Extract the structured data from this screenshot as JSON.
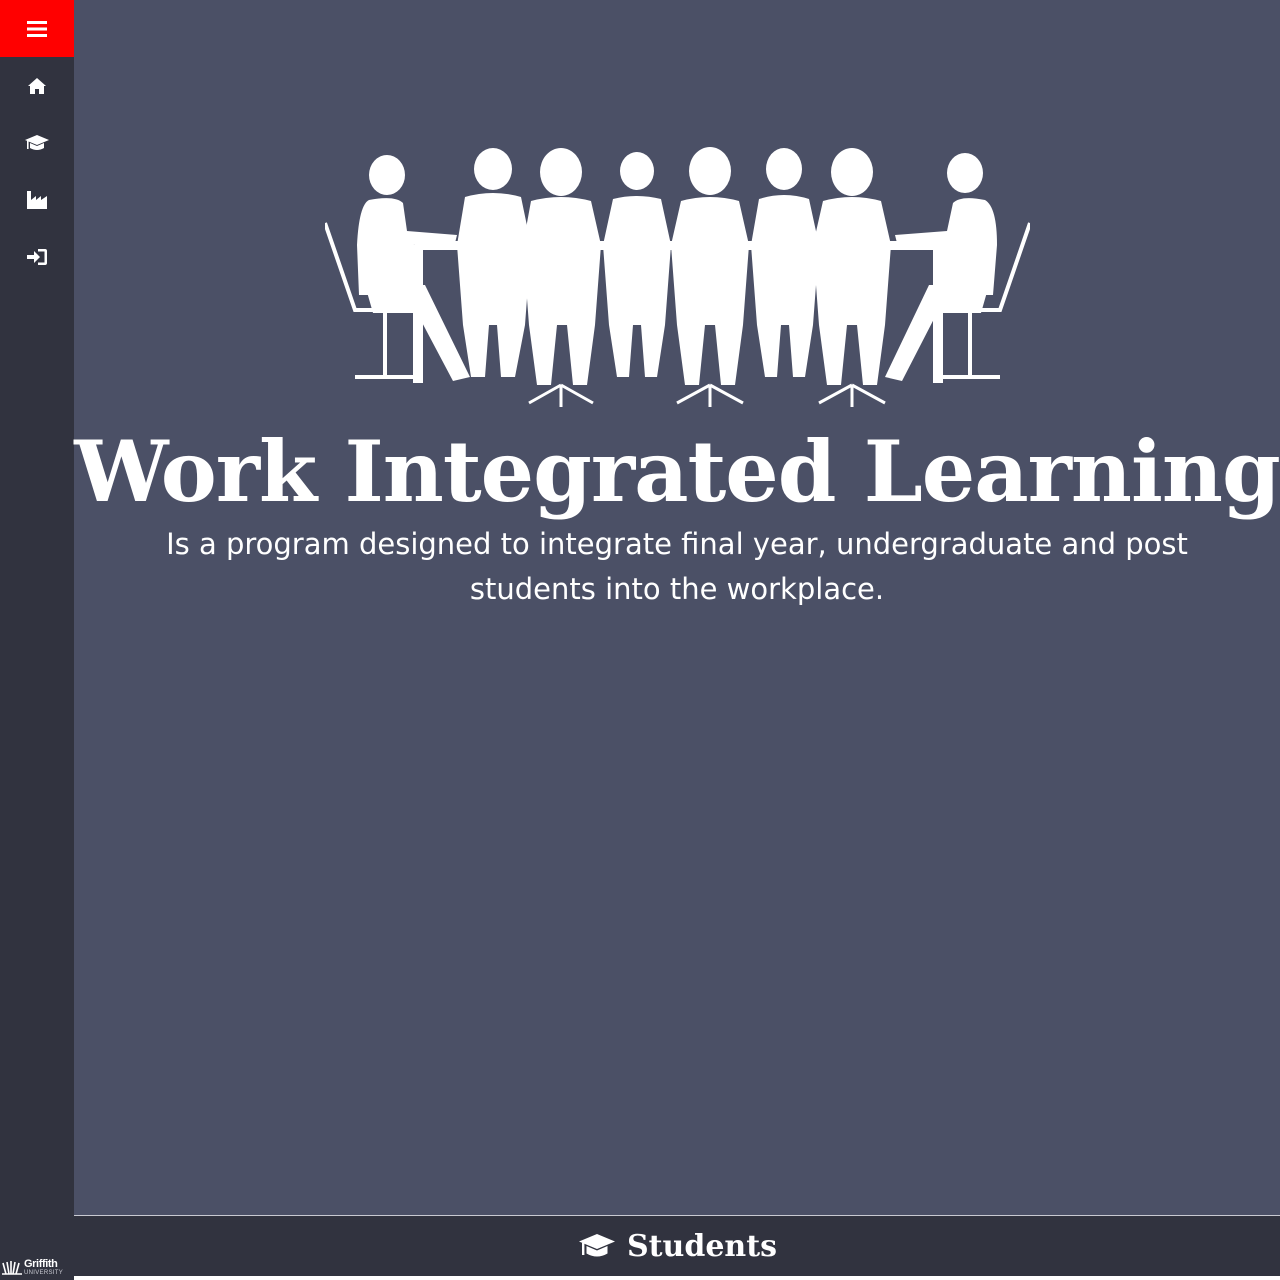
{
  "sidebar": {
    "menu_icon": "bars-icon",
    "menu_color": "#ff0000",
    "items": [
      {
        "icon": "home-icon"
      },
      {
        "icon": "graduation-cap-icon"
      },
      {
        "icon": "industry-icon"
      },
      {
        "icon": "sign-in-icon"
      }
    ],
    "logo": {
      "name": "Griffith",
      "sub": "UNIVERSITY"
    }
  },
  "hero": {
    "illustration": "meeting-table-people-icon",
    "title": "Work Integrated Learning",
    "description": "Is a program designed to integrate final year, undergraduate and post students into the workplace."
  },
  "section": {
    "icon": "graduation-cap-icon",
    "title": "Students"
  },
  "colors": {
    "background": "#4b5066",
    "sidebar": "#31333f",
    "accent": "#ff0000",
    "text": "#ffffff"
  }
}
